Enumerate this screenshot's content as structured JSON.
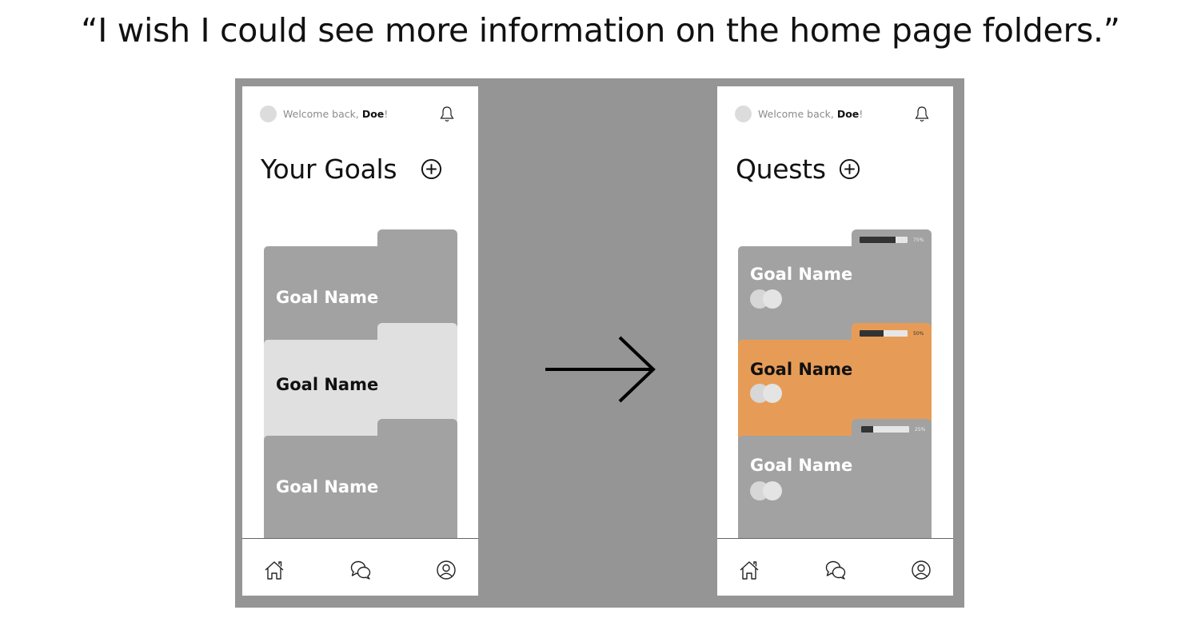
{
  "headline": "“I wish I could see more information on the home page folders.”",
  "left_screen": {
    "welcome_prefix": "Welcome back, ",
    "user": "Doe",
    "welcome_suffix": "!",
    "title": "Your Goals",
    "folders": [
      {
        "name": "Goal Name",
        "color": "#a2a2a2"
      },
      {
        "name": "Goal Name",
        "color": "#e0e0e0"
      },
      {
        "name": "Goal Name",
        "color": "#a2a2a2"
      }
    ]
  },
  "right_screen": {
    "welcome_prefix": "Welcome back, ",
    "user": "Doe",
    "welcome_suffix": "!",
    "title": "Quests",
    "folders": [
      {
        "name": "Goal Name",
        "progress": 0.75,
        "progress_label": "75%",
        "color": "#a2a2a2"
      },
      {
        "name": "Goal Name",
        "progress": 0.5,
        "progress_label": "50%",
        "color": "#e69c57"
      },
      {
        "name": "Goal Name",
        "progress": 0.25,
        "progress_label": "25%",
        "color": "#a2a2a2"
      }
    ]
  },
  "icons": {
    "bell": "bell-icon",
    "add": "plus-circle-icon",
    "nav": [
      "home-icon",
      "chat-bubbles-icon",
      "profile-icon"
    ],
    "transition": "arrow-right-icon"
  },
  "colors": {
    "background_board": "#959595",
    "folder_grey": "#a2a2a2",
    "folder_light": "#e0e0e0",
    "folder_orange": "#e69c57"
  }
}
